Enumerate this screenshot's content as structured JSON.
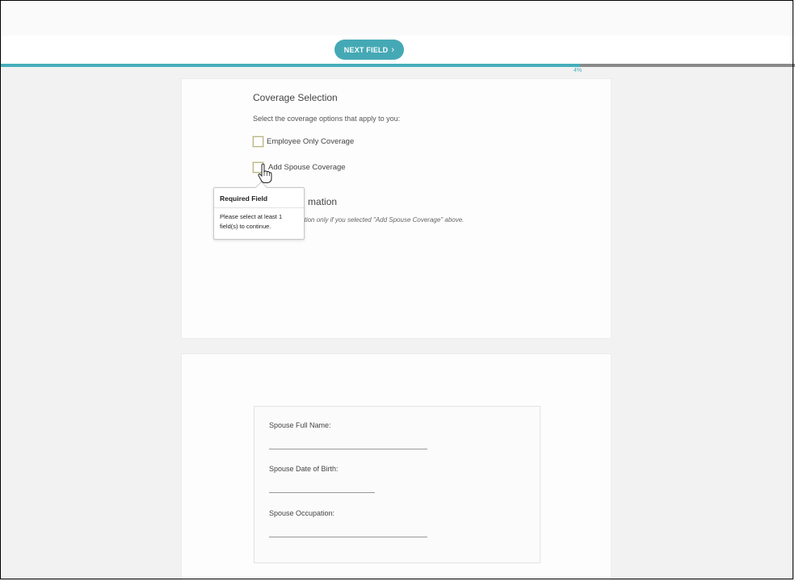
{
  "toolbar": {
    "next_field_label": "NEXT FIELD",
    "next_field_chevron": "›"
  },
  "progress": {
    "percent": 73,
    "label": "4%"
  },
  "coverage": {
    "title": "Coverage Selection",
    "instructions": "Select the coverage options that apply to you:",
    "options": [
      {
        "label": "Employee Only Coverage",
        "checked": false
      },
      {
        "label": "Add Spouse Coverage",
        "checked": false
      }
    ]
  },
  "tooltip": {
    "title": "Required Field",
    "message": "Please select at least 1 field(s) to continue."
  },
  "spouse_section": {
    "title_visible": "mation",
    "note_visible": "tion only if you selected \"Add Spouse Coverage\" above."
  },
  "spouse_fields": {
    "full_name_label": "Spouse Full Name:",
    "dob_label": "Spouse Date of Birth:",
    "occupation_label": "Spouse Occupation:"
  },
  "colors": {
    "accent": "#45a9b5",
    "progress_track": "#8a8a8a"
  }
}
